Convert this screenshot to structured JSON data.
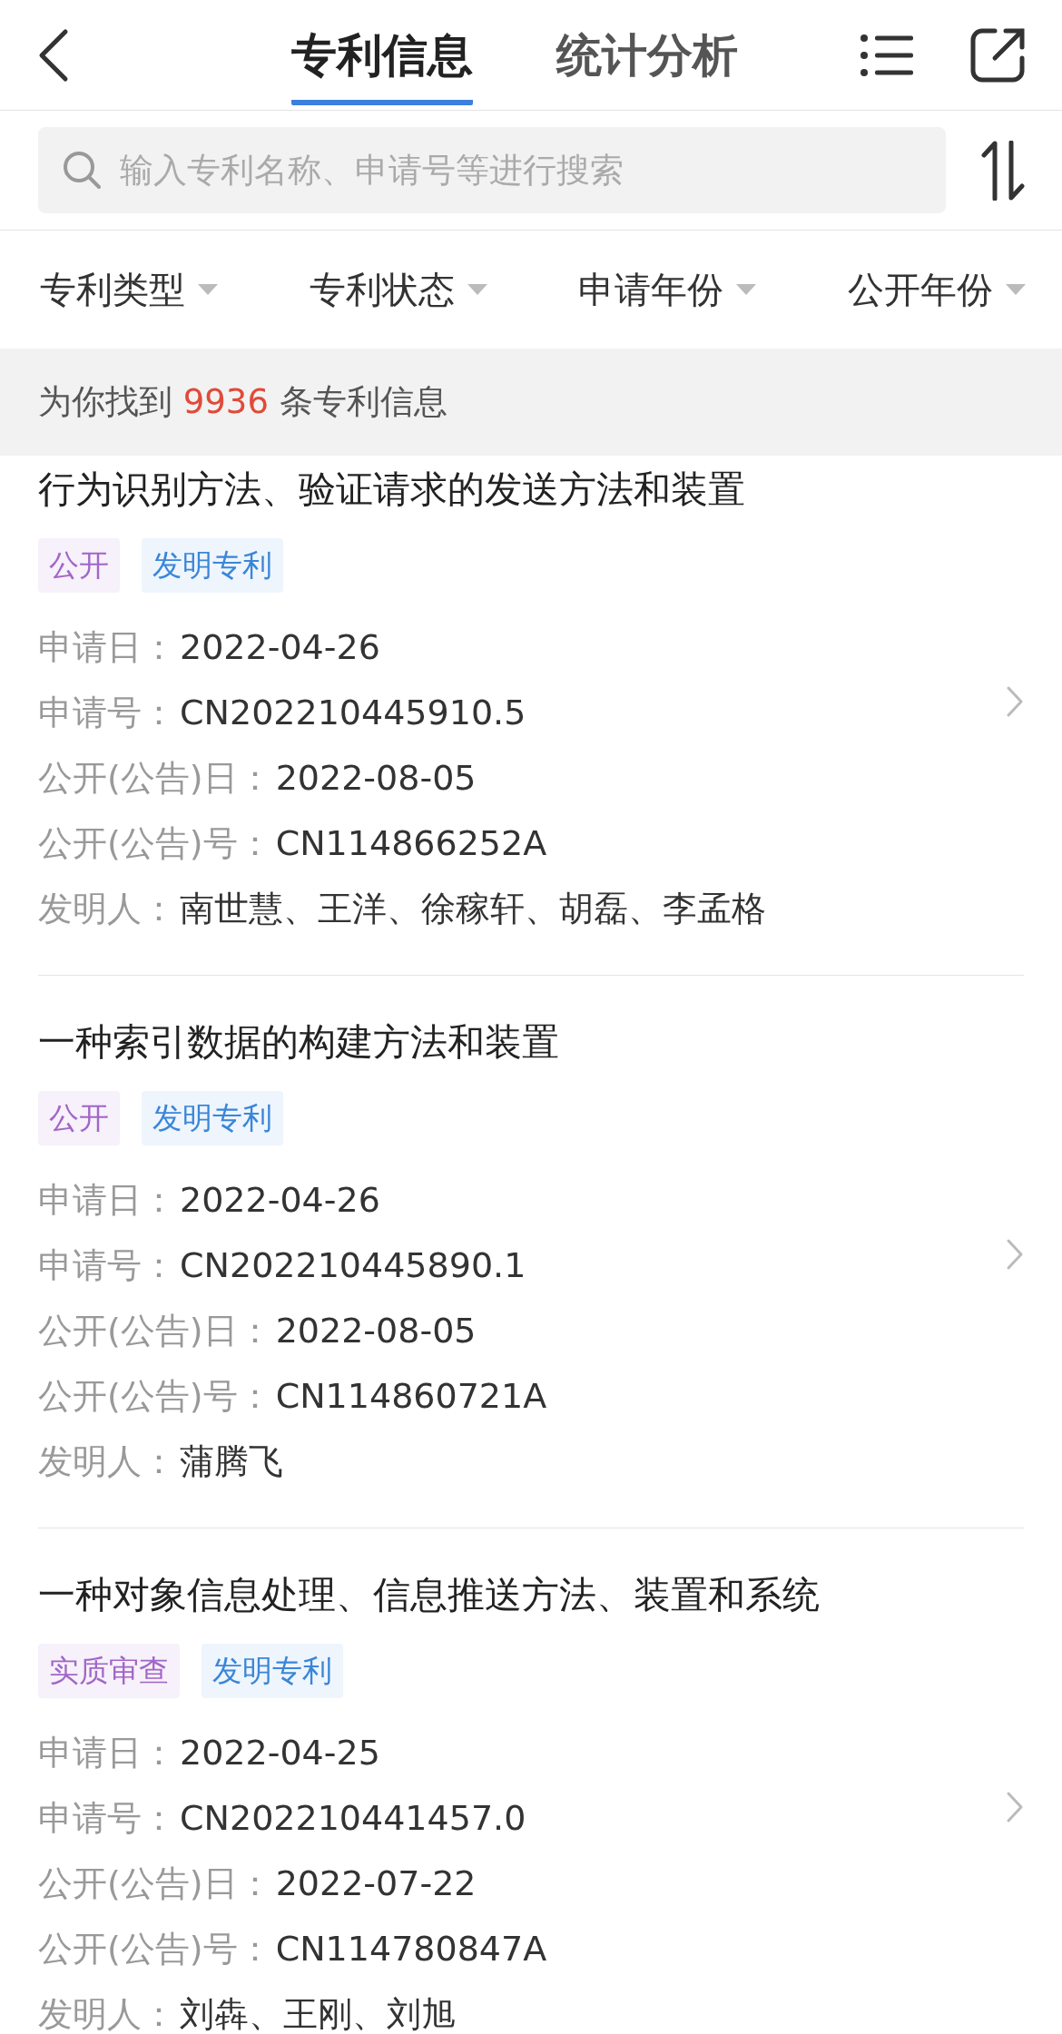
{
  "header": {
    "tabs": [
      {
        "label": "专利信息",
        "selected": true
      },
      {
        "label": "统计分析",
        "selected": false
      }
    ]
  },
  "search": {
    "placeholder": "输入专利名称、申请号等进行搜索"
  },
  "filters": [
    "专利类型",
    "专利状态",
    "申请年份",
    "公开年份"
  ],
  "result_count": {
    "prefix": "为你找到",
    "count": "9936",
    "suffix": "条专利信息"
  },
  "patents": [
    {
      "title": "行为识别方法、验证请求的发送方法和装置",
      "tags": [
        {
          "kind": "status",
          "label": "公开"
        },
        {
          "kind": "type",
          "label": "发明专利"
        }
      ],
      "fields": [
        {
          "label": "申请日：",
          "value": "2022-04-26"
        },
        {
          "label": "申请号：",
          "value": "CN202210445910.5"
        },
        {
          "label": "公开(公告)日：",
          "value": "2022-08-05"
        },
        {
          "label": "公开(公告)号：",
          "value": "CN114866252A"
        },
        {
          "label": "发明人：",
          "value": "南世慧、王洋、徐稼轩、胡磊、李孟格"
        }
      ]
    },
    {
      "title": "一种索引数据的构建方法和装置",
      "tags": [
        {
          "kind": "status",
          "label": "公开"
        },
        {
          "kind": "type",
          "label": "发明专利"
        }
      ],
      "fields": [
        {
          "label": "申请日：",
          "value": "2022-04-26"
        },
        {
          "label": "申请号：",
          "value": "CN202210445890.1"
        },
        {
          "label": "公开(公告)日：",
          "value": "2022-08-05"
        },
        {
          "label": "公开(公告)号：",
          "value": "CN114860721A"
        },
        {
          "label": "发明人：",
          "value": "蒲腾飞"
        }
      ]
    },
    {
      "title": "一种对象信息处理、信息推送方法、装置和系统",
      "tags": [
        {
          "kind": "status",
          "label": "实质审查"
        },
        {
          "kind": "type",
          "label": "发明专利"
        }
      ],
      "fields": [
        {
          "label": "申请日：",
          "value": "2022-04-25"
        },
        {
          "label": "申请号：",
          "value": "CN202210441457.0"
        },
        {
          "label": "公开(公告)日：",
          "value": "2022-07-22"
        },
        {
          "label": "公开(公告)号：",
          "value": "CN114780847A"
        },
        {
          "label": "发明人：",
          "value": "刘犇、王刚、刘旭"
        }
      ]
    }
  ]
}
